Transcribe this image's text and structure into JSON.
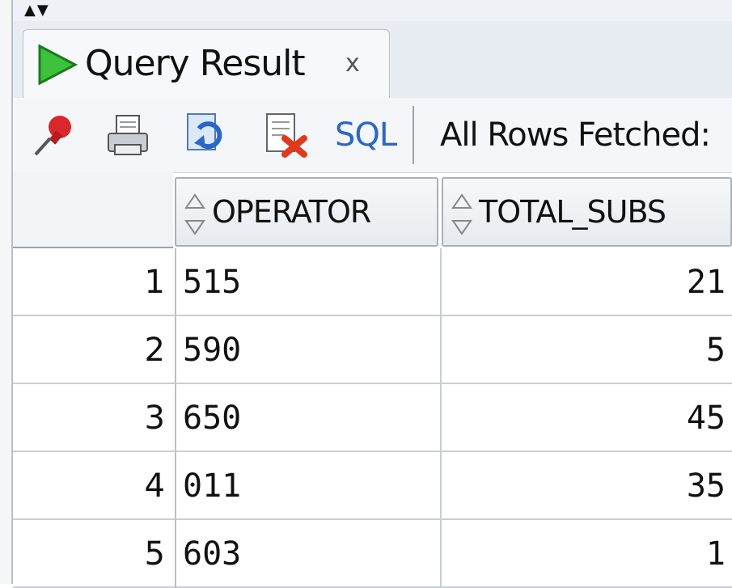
{
  "window": {
    "top_arrows": "▲▼"
  },
  "tab": {
    "label": "Query Result",
    "close": "x",
    "icon": "play-icon",
    "icon_color": "#2fb02f"
  },
  "toolbar": {
    "icons": [
      "pin-icon",
      "print-icon",
      "refresh-icon",
      "export-icon"
    ],
    "sql_label": "SQL",
    "status": "All Rows Fetched:"
  },
  "grid": {
    "columns": [
      "OPERATOR",
      "TOTAL_SUBS"
    ],
    "rows": [
      {
        "num": "1",
        "operator": "515",
        "total": "21"
      },
      {
        "num": "2",
        "operator": "590",
        "total": "5"
      },
      {
        "num": "3",
        "operator": "650",
        "total": "45"
      },
      {
        "num": "4",
        "operator": "011",
        "total": "35"
      },
      {
        "num": "5",
        "operator": "603",
        "total": "1"
      }
    ]
  }
}
